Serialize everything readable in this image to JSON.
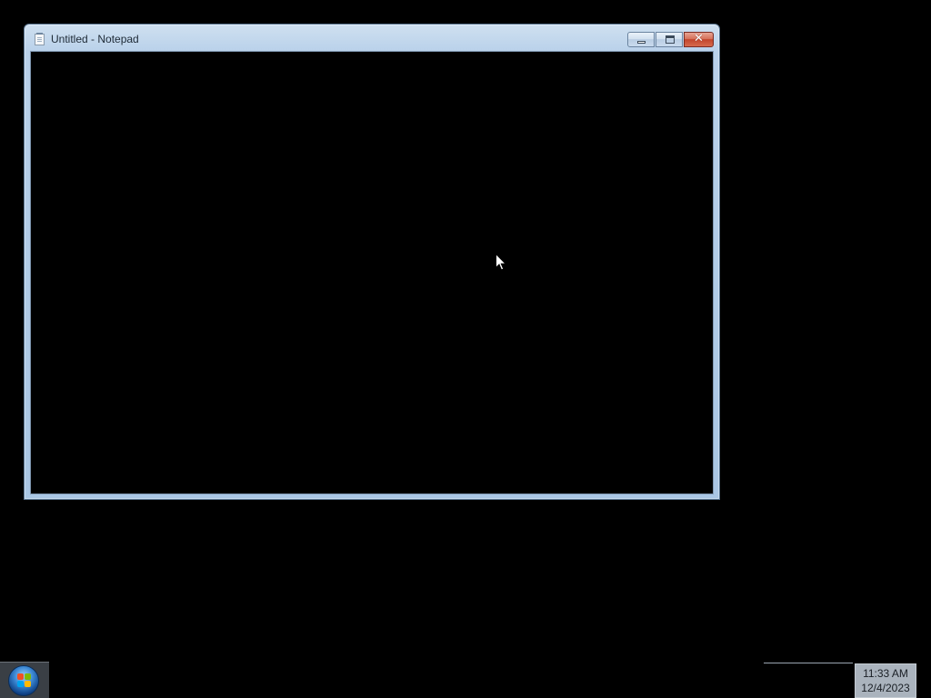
{
  "window": {
    "title": "Untitled - Notepad",
    "icon": "notepad-icon",
    "buttons": {
      "minimize": "minimize-icon",
      "maximize": "maximize-icon",
      "close": "close-icon",
      "close_glyph": "✕"
    },
    "document_text": ""
  },
  "taskbar": {
    "start_icon": "windows-start-orb-icon",
    "clock": {
      "time": "11:33 AM",
      "date": "12/4/2023"
    }
  },
  "colors": {
    "desktop_background": "#000000",
    "window_frame": "#b9d1ea",
    "close_button": "#c2452c",
    "editor_background": "#000000"
  }
}
